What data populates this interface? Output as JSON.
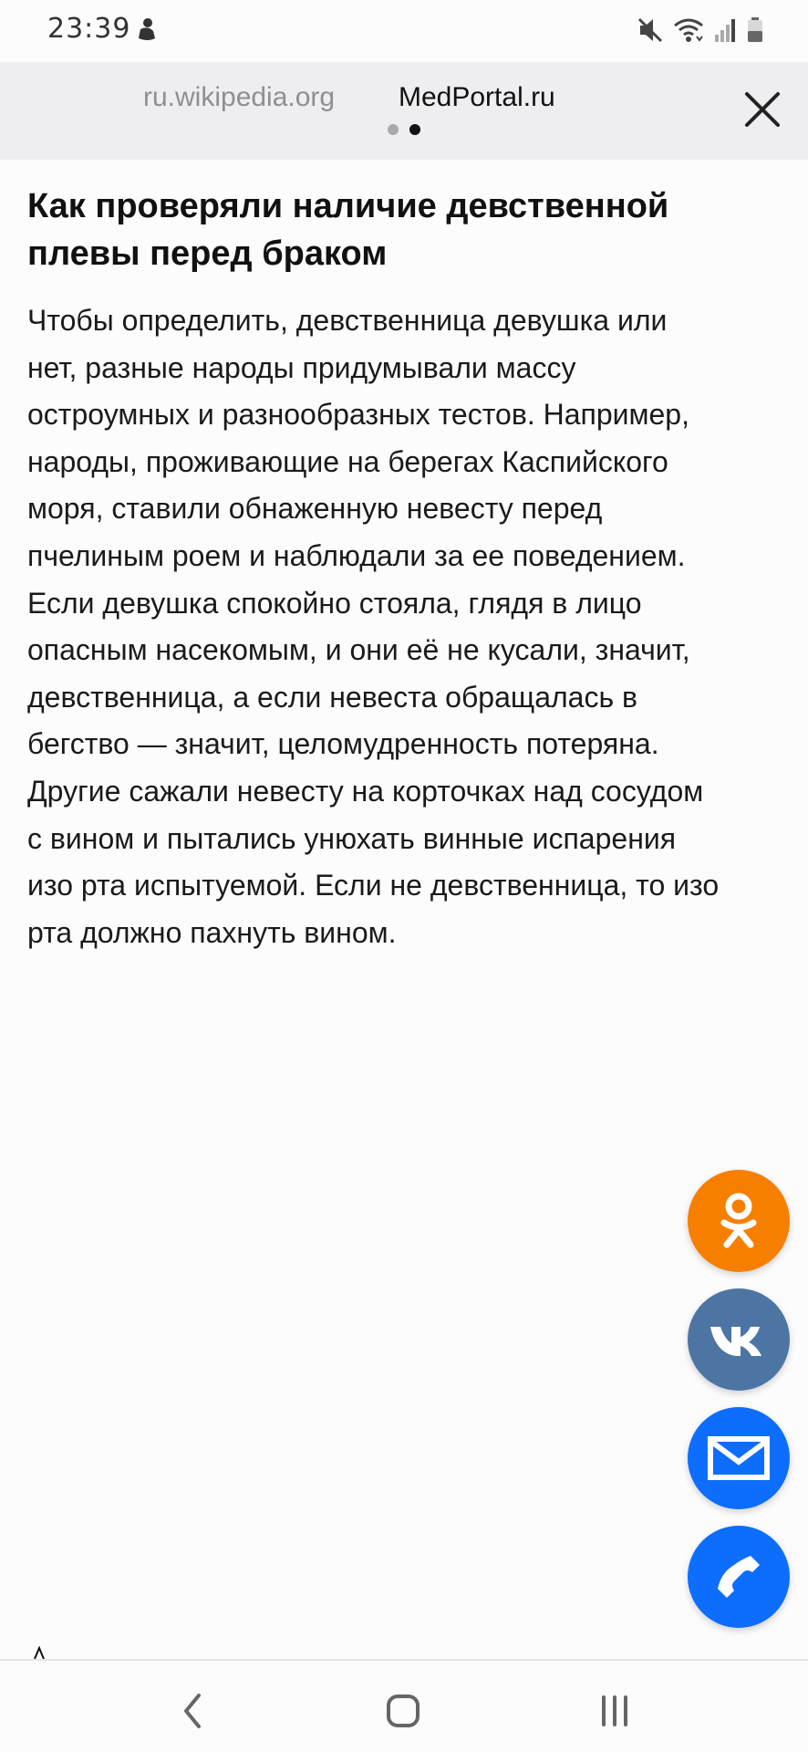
{
  "status_bar": {
    "time": "23:39",
    "icons": [
      "notification-figure-icon",
      "mute-icon",
      "wifi-icon",
      "signal-icon",
      "battery-icon"
    ]
  },
  "tabs": [
    {
      "label": "ru.wikipedia.org",
      "active": false
    },
    {
      "label": "MedPortal.ru",
      "active": true
    }
  ],
  "article": {
    "title": "Как проверяли наличие девственной плевы перед браком",
    "lines": [
      "Чтобы определить, девственница девушка или",
      "нет, разные народы придумывали массу",
      "остроумных и разнообразных тестов. Например,",
      "народы, проживающие на берегах Каспийского",
      "моря, ставили обнаженную невесту перед",
      "пчелиным роем и наблюдали за ее поведением.",
      "Если девушка спокойно стояла, глядя в лицо",
      "опасным насекомым, и они её не кусали, значит,",
      "девственница, а если невеста обращалась в",
      "бегство — значит, целомудренность потеряна.",
      "Другие сажали невесту на корточках над сосудом",
      "с вином и пытались унюхать винные испарения",
      "изо рта испытуемой. Если не девственница, то изо",
      "рта должно пахнуть вином."
    ]
  },
  "share_buttons": [
    {
      "name": "odnoklassniki-icon",
      "color": "#f77f00"
    },
    {
      "name": "vk-icon",
      "color": "#4c75a3"
    },
    {
      "name": "mail-icon",
      "color": "#0d6efd"
    },
    {
      "name": "phone-icon",
      "color": "#0d6efd"
    }
  ],
  "nav_bar": [
    "back-icon",
    "home-icon",
    "recents-icon"
  ]
}
